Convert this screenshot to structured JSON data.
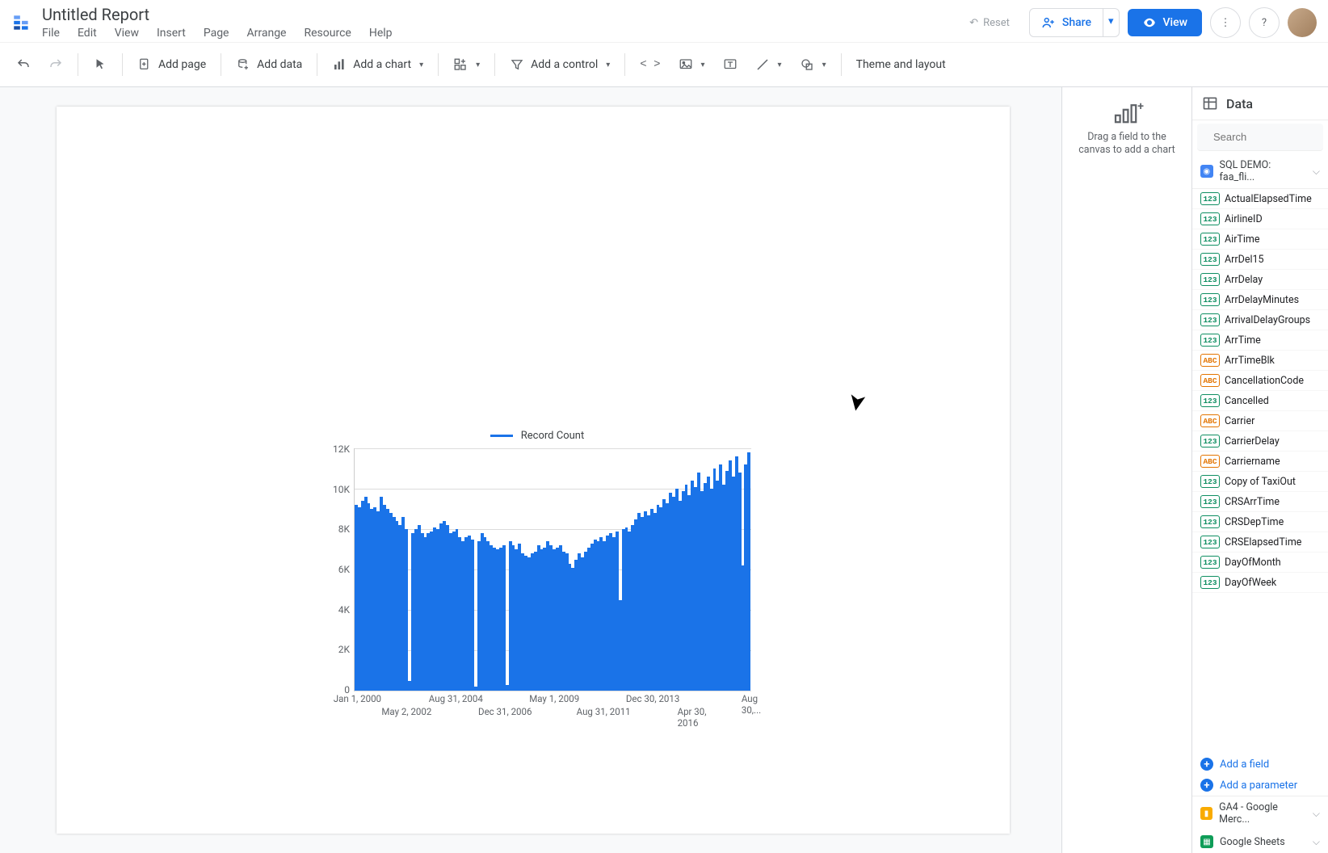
{
  "header": {
    "doc_title": "Untitled Report",
    "menus": [
      "File",
      "Edit",
      "View",
      "Insert",
      "Page",
      "Arrange",
      "Resource",
      "Help"
    ],
    "reset": "Reset",
    "share": "Share",
    "view": "View"
  },
  "toolbar": {
    "add_page": "Add page",
    "add_data": "Add data",
    "add_chart": "Add a chart",
    "add_control": "Add a control",
    "theme_layout": "Theme and layout"
  },
  "side_drag": {
    "line1": "Drag a field to the",
    "line2": "canvas to add a chart"
  },
  "side_data": {
    "heading": "Data",
    "search_placeholder": "Search",
    "data_sources": [
      {
        "id": "bq",
        "label": "SQL DEMO: faa_fli..."
      },
      {
        "id": "ga",
        "label": "GA4 - Google Merc..."
      },
      {
        "id": "gs",
        "label": "Google Sheets"
      }
    ],
    "add_field": "Add a field",
    "add_parameter": "Add a parameter",
    "fields": [
      {
        "type": "num",
        "name": "ActualElapsedTime"
      },
      {
        "type": "num",
        "name": "AirlineID"
      },
      {
        "type": "num",
        "name": "AirTime"
      },
      {
        "type": "num",
        "name": "ArrDel15"
      },
      {
        "type": "num",
        "name": "ArrDelay"
      },
      {
        "type": "num",
        "name": "ArrDelayMinutes"
      },
      {
        "type": "num",
        "name": "ArrivalDelayGroups"
      },
      {
        "type": "num",
        "name": "ArrTime"
      },
      {
        "type": "abc",
        "name": "ArrTimeBlk"
      },
      {
        "type": "abc",
        "name": "CancellationCode"
      },
      {
        "type": "num",
        "name": "Cancelled"
      },
      {
        "type": "abc",
        "name": "Carrier"
      },
      {
        "type": "num",
        "name": "CarrierDelay"
      },
      {
        "type": "abc",
        "name": "Carriername"
      },
      {
        "type": "num",
        "name": "Copy of TaxiOut"
      },
      {
        "type": "num",
        "name": "CRSArrTime"
      },
      {
        "type": "num",
        "name": "CRSDepTime"
      },
      {
        "type": "num",
        "name": "CRSElapsedTime"
      },
      {
        "type": "num",
        "name": "DayOfMonth"
      },
      {
        "type": "num",
        "name": "DayOfWeek"
      }
    ]
  },
  "chart_data": {
    "type": "line",
    "title": "",
    "legend": "Record Count",
    "ylabel": "",
    "xlabel": "",
    "ylim": [
      0,
      12000
    ],
    "y_ticks": [
      "12K",
      "10K",
      "8K",
      "6K",
      "4K",
      "2K",
      "0"
    ],
    "x_ticks_row1": [
      "Jan 1, 2000",
      "Aug 31, 2004",
      "May 1, 2009",
      "Dec 30, 2013",
      "Aug 30,..."
    ],
    "x_ticks_row2": [
      "May 2, 2002",
      "Dec 31, 2006",
      "Aug 31, 2011",
      "Apr 30, 2016"
    ],
    "series": [
      {
        "name": "Record Count",
        "values": [
          9200,
          9100,
          9400,
          9600,
          9300,
          9000,
          9100,
          8900,
          9600,
          9200,
          9000,
          8800,
          8600,
          8400,
          8200,
          8600,
          8000,
          500,
          7800,
          8000,
          8200,
          7800,
          7600,
          7800,
          7900,
          8100,
          8000,
          8300,
          8400,
          8200,
          7800,
          7900,
          8000,
          7600,
          7400,
          7600,
          7700,
          7500,
          200,
          7400,
          7800,
          7600,
          7400,
          7200,
          7100,
          7000,
          7100,
          7200,
          300,
          7400,
          7200,
          7000,
          7300,
          6800,
          6700,
          6600,
          6800,
          6900,
          7200,
          7000,
          7100,
          7400,
          7200,
          7000,
          7100,
          7200,
          6900,
          6800,
          6300,
          6100,
          6500,
          6800,
          6600,
          6900,
          7100,
          7300,
          7500,
          7400,
          7600,
          7400,
          7700,
          7800,
          7600,
          7900,
          4500,
          8000,
          8100,
          7900,
          8200,
          8500,
          8800,
          8600,
          8900,
          8700,
          9000,
          8800,
          9200,
          9100,
          9500,
          9300,
          9800,
          9600,
          10000,
          9400,
          9900,
          10200,
          9700,
          10400,
          10100,
          10800,
          9900,
          10300,
          10600,
          10000,
          11000,
          10400,
          11200,
          10200,
          10900,
          11400,
          10600,
          11600,
          10800,
          6200,
          11200,
          11800
        ]
      }
    ]
  }
}
